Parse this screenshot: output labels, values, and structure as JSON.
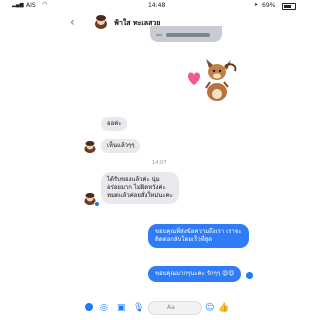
{
  "status_bar": {
    "carrier": "AIS",
    "time": "14:48",
    "battery": "69%"
  },
  "header": {
    "contact_name": "ฟ้าใส ทะเลสวย"
  },
  "messages": {
    "m1": "ออค่ะ",
    "m2": "เห็นแล้วๆๆ",
    "timestamp": "14:07",
    "m3": [
      "ได้รับของแล้วค่ะ นุ่ม",
      "อร่อยมาก ไม่ผิดหวังค่ะ",
      "หมดแล้วค่อยสั่งใหม่นะคะ"
    ],
    "m4": [
      "ขอบคุณที่ส่งข้อความถึงเรา เราจะ",
      "ติดต่อกลับโดยเร็วที่สุด"
    ],
    "m5": "ขอบคุณมากๆนะคะ รักๆๆ 😍😍"
  },
  "composer": {
    "placeholder": "Aa"
  },
  "colors": {
    "accent": "#1c7cf5",
    "outgoing_bubble": "#2f7cf6",
    "incoming_bubble": "#e9e9ed"
  }
}
